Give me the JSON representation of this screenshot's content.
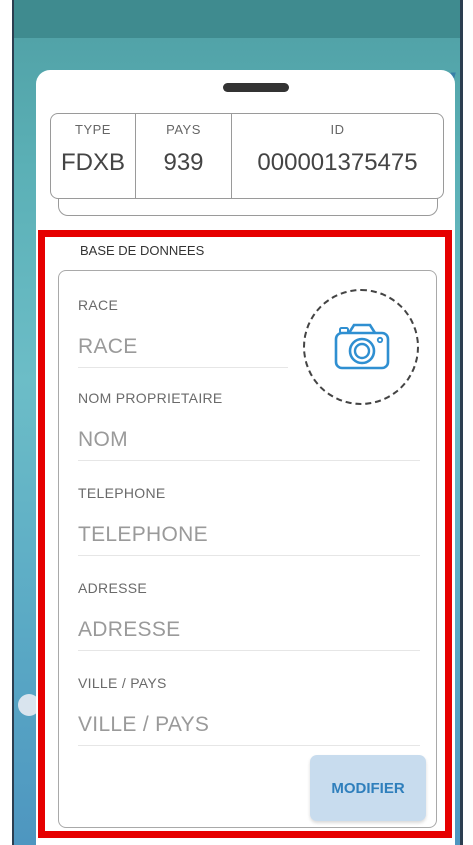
{
  "id_panel": {
    "type_label": "TYPE",
    "type_value": "FDXB",
    "pays_label": "PAYS",
    "pays_value": "939",
    "id_label": "ID",
    "id_value": "000001375475"
  },
  "database": {
    "title": "BASE DE DONNEES",
    "fields": [
      {
        "label": "RACE",
        "placeholder": "RACE"
      },
      {
        "label": "NOM PROPRIETAIRE",
        "placeholder": "NOM"
      },
      {
        "label": "TELEPHONE",
        "placeholder": "TELEPHONE"
      },
      {
        "label": "ADRESSE",
        "placeholder": "ADRESSE"
      },
      {
        "label": "VILLE / PAYS",
        "placeholder": "VILLE / PAYS"
      }
    ],
    "photo_icon": "camera-icon",
    "modify_label": "MODIFIER"
  },
  "colors": {
    "accent": "#2f7fbc",
    "highlight": "#e60000"
  }
}
